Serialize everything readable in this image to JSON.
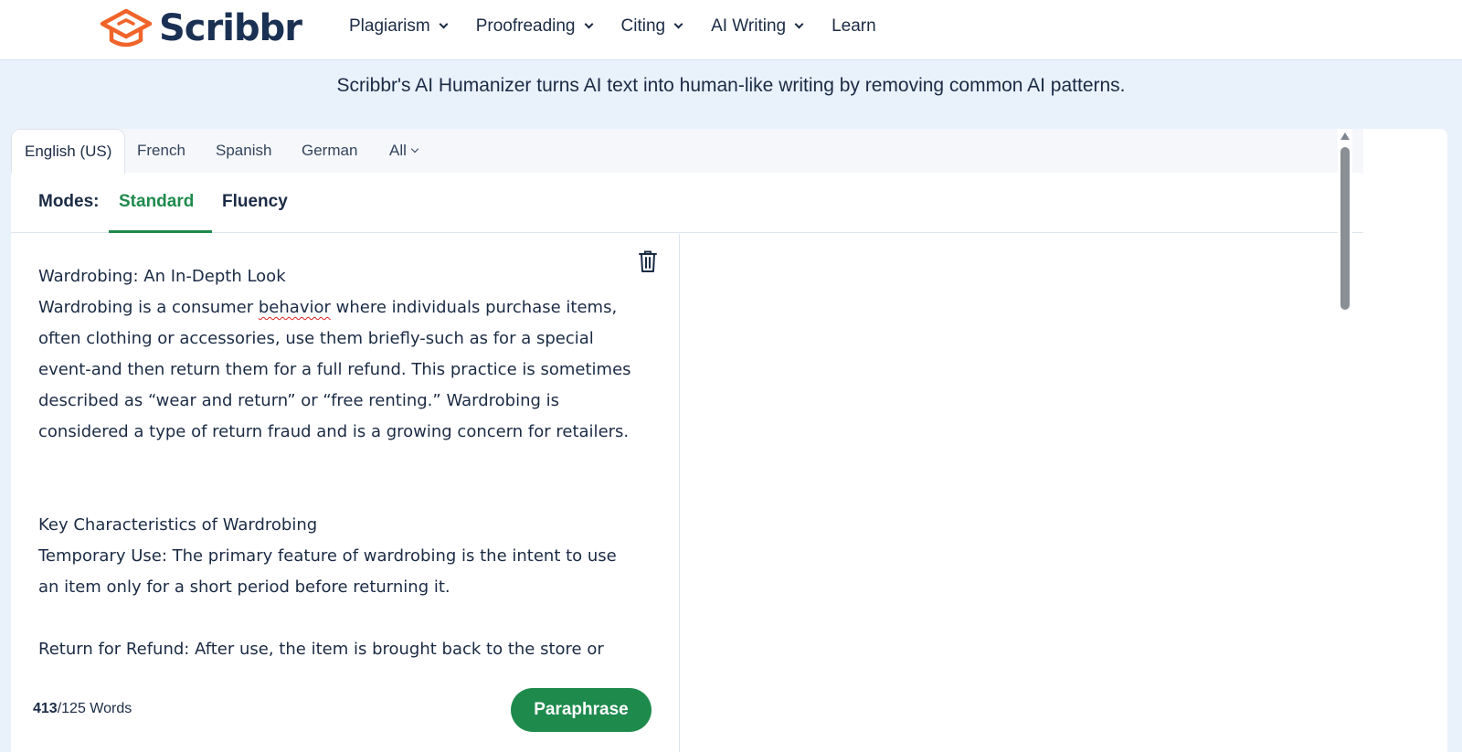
{
  "header": {
    "logo_text": "Scribbr",
    "nav": [
      {
        "label": "Plagiarism",
        "has_dropdown": true
      },
      {
        "label": "Proofreading",
        "has_dropdown": true
      },
      {
        "label": "Citing",
        "has_dropdown": true
      },
      {
        "label": "AI Writing",
        "has_dropdown": true
      },
      {
        "label": "Learn",
        "has_dropdown": false
      }
    ]
  },
  "tagline": "Scribbr's AI Humanizer turns AI text into human-like writing by removing common AI patterns.",
  "languages": {
    "tabs": [
      "English (US)",
      "French",
      "Spanish",
      "German",
      "All"
    ],
    "active": "English (US)"
  },
  "modes": {
    "label": "Modes:",
    "tabs": [
      "Standard",
      "Fluency"
    ],
    "active": "Standard"
  },
  "editor": {
    "title": "Wardrobing: An In-Depth Look",
    "para1_before": "Wardrobing is a consumer ",
    "para1_misspelled": "behavior",
    "para1_after": " where individuals purchase items, often clothing or accessories, use them briefly-such as for a special event-and then return them for a full refund. This practice is sometimes described as “wear and return” or “free renting.” Wardrobing is considered a type of return fraud and is a growing concern for retailers.",
    "heading2": "Key Characteristics of Wardrobing",
    "para2": "Temporary Use: The primary feature of wardrobing is the intent to use an item only for a short period before returning it.",
    "para3": "Return for Refund: After use, the item is brought back to the store or"
  },
  "footer": {
    "word_count_current": "413",
    "word_count_limit": "/125 Words",
    "paraphrase_label": "Paraphrase"
  },
  "colors": {
    "brand_orange": "#f0642a",
    "brand_navy": "#1b3154",
    "accent_green": "#1e8a4c",
    "page_bg": "#e9f1fb"
  },
  "icons": [
    "logo-icon",
    "chevron-down-icon",
    "trash-icon",
    "scroll-up-icon"
  ]
}
